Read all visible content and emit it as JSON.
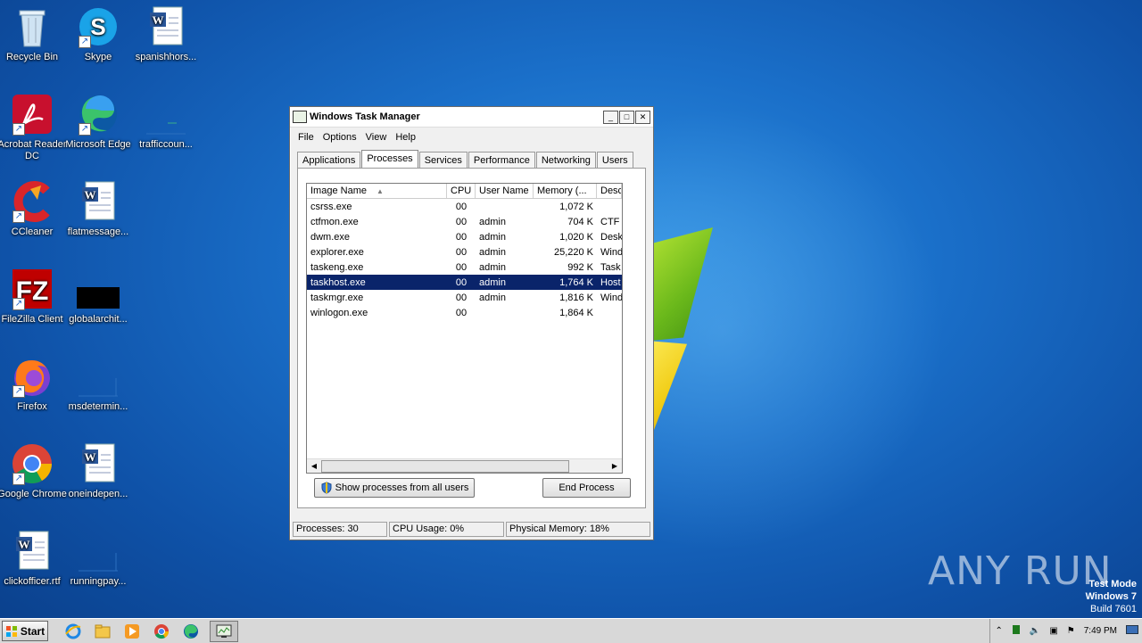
{
  "desktop_icons": [
    {
      "label": "Recycle Bin",
      "icon": "recycle-bin-icon"
    },
    {
      "label": "Skype",
      "icon": "skype-icon"
    },
    {
      "label": "spanishhors...",
      "icon": "word-doc-icon"
    },
    {
      "label": "Acrobat Reader DC",
      "icon": "acrobat-icon"
    },
    {
      "label": "Microsoft Edge",
      "icon": "edge-icon"
    },
    {
      "label": "trafficcoun...",
      "icon": "blank-file-icon"
    },
    {
      "label": "CCleaner",
      "icon": "ccleaner-icon"
    },
    {
      "label": "flatmessage...",
      "icon": "word-doc-icon"
    },
    {
      "label": "FileZilla Client",
      "icon": "filezilla-icon"
    },
    {
      "label": "globalarchit...",
      "icon": "black-thumbnail-icon"
    },
    {
      "label": "Firefox",
      "icon": "firefox-icon"
    },
    {
      "label": "msdetermin...",
      "icon": "blank-file-icon"
    },
    {
      "label": "Google Chrome",
      "icon": "chrome-icon"
    },
    {
      "label": "oneindepen...",
      "icon": "word-doc-icon"
    },
    {
      "label": "clickofficer.rtf",
      "icon": "word-doc-icon"
    },
    {
      "label": "runningpay...",
      "icon": "blank-file-icon"
    }
  ],
  "window": {
    "title": "Windows Task Manager",
    "menu": [
      "File",
      "Options",
      "View",
      "Help"
    ],
    "tabs": [
      "Applications",
      "Processes",
      "Services",
      "Performance",
      "Networking",
      "Users"
    ],
    "active_tab": "Processes",
    "columns": [
      "Image Name",
      "CPU",
      "User Name",
      "Memory (...",
      "Desc"
    ],
    "sort_indicator": "▲",
    "processes": [
      {
        "name": "csrss.exe",
        "cpu": "00",
        "user": "",
        "mem": "1,072 K",
        "desc": ""
      },
      {
        "name": "ctfmon.exe",
        "cpu": "00",
        "user": "admin",
        "mem": "704 K",
        "desc": "CTF I"
      },
      {
        "name": "dwm.exe",
        "cpu": "00",
        "user": "admin",
        "mem": "1,020 K",
        "desc": "Desk"
      },
      {
        "name": "explorer.exe",
        "cpu": "00",
        "user": "admin",
        "mem": "25,220 K",
        "desc": "Wind"
      },
      {
        "name": "taskeng.exe",
        "cpu": "00",
        "user": "admin",
        "mem": "992 K",
        "desc": "Task"
      },
      {
        "name": "taskhost.exe",
        "cpu": "00",
        "user": "admin",
        "mem": "1,764 K",
        "desc": "Host",
        "selected": true
      },
      {
        "name": "taskmgr.exe",
        "cpu": "00",
        "user": "admin",
        "mem": "1,816 K",
        "desc": "Wind"
      },
      {
        "name": "winlogon.exe",
        "cpu": "00",
        "user": "",
        "mem": "1,864 K",
        "desc": ""
      }
    ],
    "show_all_button": "Show processes from all users",
    "end_process_button": "End Process",
    "status": {
      "processes": "Processes: 30",
      "cpu": "CPU Usage: 0%",
      "memory": "Physical Memory: 18%"
    }
  },
  "taskbar": {
    "start_label": "Start",
    "clock": "7:49 PM",
    "pinned": [
      "ie-icon",
      "explorer-folder-icon",
      "media-player-icon",
      "chrome-icon",
      "edge-icon",
      "task-manager-icon"
    ]
  },
  "watermark": {
    "line1": "Test Mode",
    "line2": "Windows 7",
    "line3": "Build 7601",
    "brand": "ANY RUN"
  }
}
